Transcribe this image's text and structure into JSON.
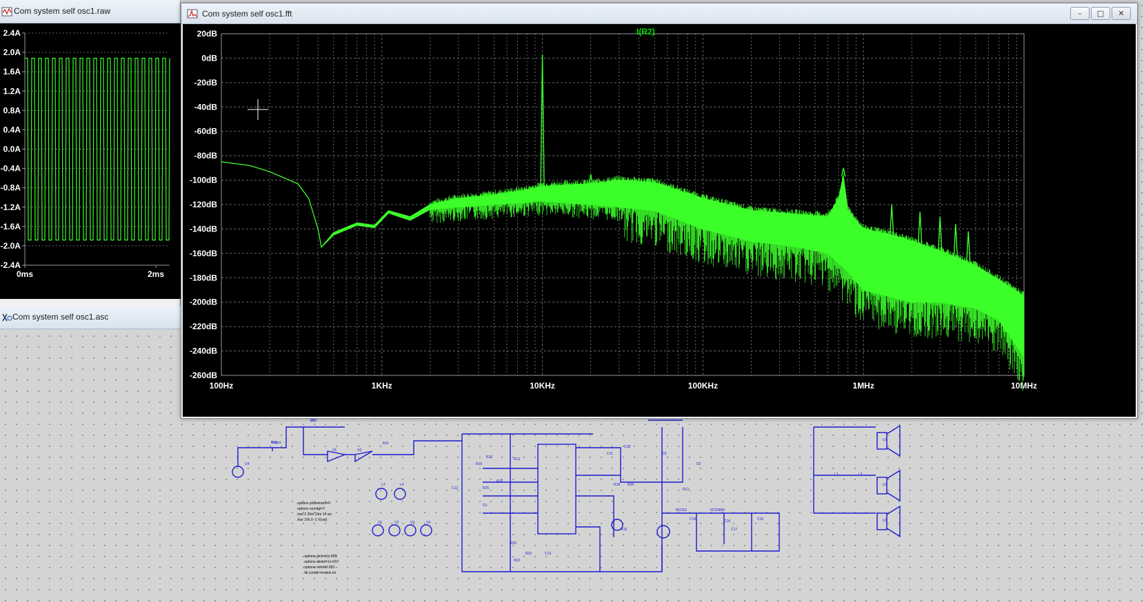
{
  "colors": {
    "plot_background": "#000000",
    "trace_green": "#3cff2a",
    "grid": "#6a6a6a",
    "schematic_wire": "#1a1ad0",
    "sheet_background": "#d4d4d4"
  },
  "waveform_window": {
    "title": "Com system self osc1.raw",
    "icon": "waveform-icon",
    "y_ticks": [
      "2.4A",
      "2.0A",
      "1.6A",
      "1.2A",
      "0.8A",
      "0.4A",
      "0.0A",
      "-0.4A",
      "-0.8A",
      "-1.2A",
      "-1.6A",
      "-2.0A",
      "-2.4A"
    ],
    "x_ticks": [
      "0ms",
      "2ms"
    ]
  },
  "schematic_window": {
    "title": "Com system self osc1.asc",
    "icon": "schematic-icon"
  },
  "fft_window": {
    "title": "Com system self osc1.fft",
    "icon": "fft-icon",
    "buttons": {
      "minimize": "–",
      "maximize": "□",
      "close": "✕"
    },
    "trace_name": "I(R2)"
  },
  "chart_data": {
    "type": "line",
    "title": "",
    "series": [
      {
        "name": "I(R2)",
        "color": "#3cff2a"
      }
    ],
    "xlabel": "",
    "ylabel": "",
    "x_scale": "log",
    "xlim": [
      100,
      10000000
    ],
    "ylim": [
      -260,
      20
    ],
    "x_ticks": [
      "100Hz",
      "1KHz",
      "10KHz",
      "100KHz",
      "1MHz",
      "10MHz"
    ],
    "y_ticks": [
      "20dB",
      "0dB",
      "-20dB",
      "-40dB",
      "-60dB",
      "-80dB",
      "-100dB",
      "-120dB",
      "-140dB",
      "-160dB",
      "-180dB",
      "-200dB",
      "-220dB",
      "-240dB",
      "-260dB"
    ],
    "grid": true,
    "envelope_top": [
      [
        100,
        -85
      ],
      [
        150,
        -88
      ],
      [
        200,
        -93
      ],
      [
        300,
        -103
      ],
      [
        350,
        -115
      ],
      [
        400,
        -140
      ],
      [
        420,
        -155
      ],
      [
        500,
        -143
      ],
      [
        700,
        -135
      ],
      [
        900,
        -137
      ],
      [
        1100,
        -125
      ],
      [
        1500,
        -130
      ],
      [
        2000,
        -120
      ],
      [
        3000,
        -115
      ],
      [
        5000,
        -112
      ],
      [
        8000,
        -108
      ],
      [
        10000,
        -105
      ],
      [
        20000,
        -103
      ],
      [
        30000,
        -100
      ],
      [
        50000,
        -102
      ],
      [
        100000,
        -115
      ],
      [
        200000,
        -125
      ],
      [
        400000,
        -128
      ],
      [
        600000,
        -130
      ],
      [
        700000,
        -115
      ],
      [
        750000,
        -97
      ],
      [
        800000,
        -125
      ],
      [
        1000000,
        -140
      ],
      [
        1500000,
        -145
      ],
      [
        2000000,
        -150
      ],
      [
        3000000,
        -158
      ],
      [
        5000000,
        -170
      ],
      [
        7000000,
        -182
      ],
      [
        10000000,
        -195
      ]
    ],
    "envelope_bottom": [
      [
        100,
        -85
      ],
      [
        150,
        -88
      ],
      [
        200,
        -93
      ],
      [
        300,
        -103
      ],
      [
        350,
        -115
      ],
      [
        400,
        -140
      ],
      [
        420,
        -155
      ],
      [
        500,
        -145
      ],
      [
        700,
        -137
      ],
      [
        900,
        -139
      ],
      [
        1100,
        -127
      ],
      [
        1500,
        -133
      ],
      [
        2000,
        -124
      ],
      [
        3000,
        -122
      ],
      [
        5000,
        -120
      ],
      [
        8000,
        -118
      ],
      [
        10000,
        -117
      ],
      [
        20000,
        -120
      ],
      [
        30000,
        -122
      ],
      [
        50000,
        -125
      ],
      [
        100000,
        -140
      ],
      [
        200000,
        -150
      ],
      [
        400000,
        -155
      ],
      [
        600000,
        -160
      ],
      [
        800000,
        -175
      ],
      [
        1000000,
        -190
      ],
      [
        2000000,
        -200
      ],
      [
        3000000,
        -200
      ],
      [
        5000000,
        -205
      ],
      [
        7000000,
        -215
      ],
      [
        10000000,
        -245
      ]
    ],
    "peaks": [
      [
        10000,
        3
      ],
      [
        20000,
        -95
      ],
      [
        750000,
        -90
      ],
      [
        1500000,
        -120
      ],
      [
        2250000,
        -126
      ],
      [
        3000000,
        -130
      ],
      [
        3750000,
        -136
      ],
      [
        4500000,
        -142
      ]
    ]
  },
  "schematic": {
    "notes": [
      ".options plotwinsize=0",
      ".options numdgt=7",
      ".tran 0 20m 10m 1n uic",
      ".four 10k 9 -1 V(out)",
      ".options gmin=1e-009",
      ".options abstol=1e-010",
      ".options reltol=0.003",
      ".lib cordell-models.txt"
    ],
    "labels": [
      "R14",
      "R10",
      "R11",
      "R12",
      "R13",
      "R15",
      "R16",
      "R17",
      "R18",
      "R19",
      "R20",
      "R22",
      "R23",
      "R24",
      "R25",
      "C11",
      "C12",
      "C13",
      "C14",
      "C15",
      "C16",
      "C17",
      "C18",
      "D1",
      "D2",
      "D3",
      "IR2110",
      "FDS3680",
      "L1",
      "L2",
      "L3",
      "L4",
      "V1",
      "V2",
      "V3",
      "V4",
      "V5",
      "V6",
      "U1",
      "U2",
      "U3",
      "U4",
      "U5",
      "Vinput"
    ]
  }
}
